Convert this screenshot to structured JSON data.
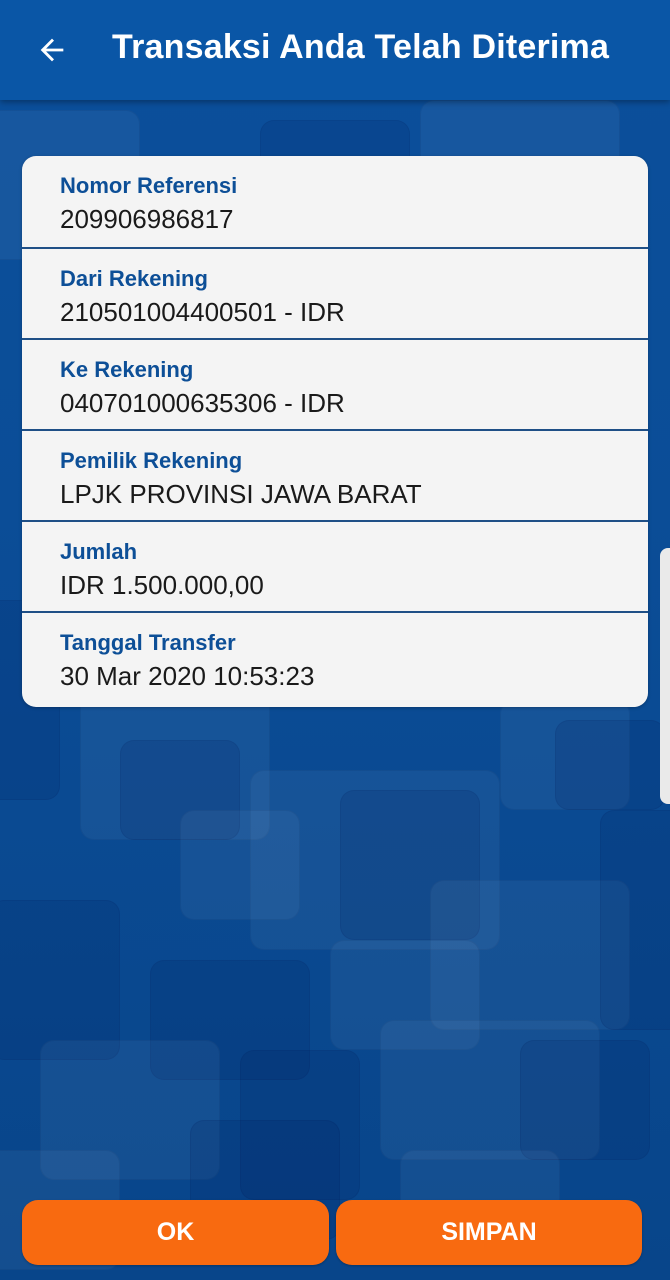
{
  "header": {
    "title": "Transaksi Anda Telah Diterima",
    "back_icon": "arrow-left-icon"
  },
  "details": [
    {
      "label": "Nomor Referensi",
      "value": "209906986817"
    },
    {
      "label": "Dari Rekening",
      "value": "210501004400501 - IDR"
    },
    {
      "label": "Ke Rekening",
      "value": "040701000635306 - IDR"
    },
    {
      "label": "Pemilik Rekening",
      "value": "LPJK PROVINSI JAWA BARAT"
    },
    {
      "label": "Jumlah",
      "value": "IDR 1.500.000,00"
    },
    {
      "label": "Tanggal Transfer",
      "value": "30 Mar 2020 10:53:23"
    }
  ],
  "actions": {
    "ok_label": "OK",
    "save_label": "SIMPAN"
  },
  "colors": {
    "header": "#0a56a6",
    "label": "#0d4f97",
    "button": "#f86a10",
    "card": "#f4f4f4"
  }
}
